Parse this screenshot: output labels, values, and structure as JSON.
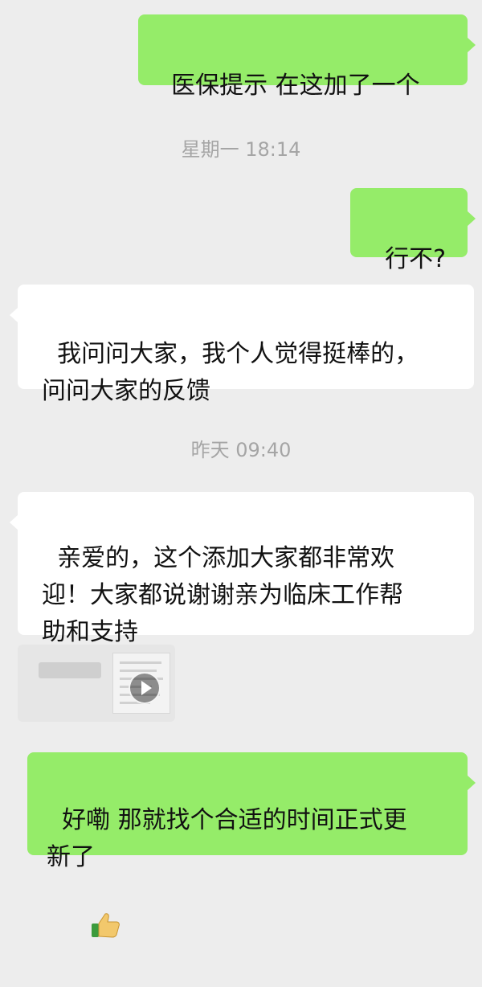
{
  "messages": {
    "m1": "医保提示 在这加了一个",
    "m2": "行不?",
    "m3": "我问问大家，我个人觉得挺棒的，\n问问大家的反馈",
    "m4": "亲爱的，这个添加大家都非常欢\n迎！大家都说谢谢亲为临床工作帮\n助和支持",
    "m5": "好嘞 那就找个合适的时间正式更\n新了"
  },
  "timestamps": {
    "t1": "星期一 18:14",
    "t2": "昨天 09:40"
  },
  "icons": {
    "rose": "rose-icon",
    "thumb": "thumbs-up-icon",
    "play": "play-icon"
  },
  "colors": {
    "outgoing_bubble": "#95ec69",
    "incoming_bubble": "#ffffff",
    "background": "#ededed",
    "timestamp": "#a5a5a5"
  }
}
